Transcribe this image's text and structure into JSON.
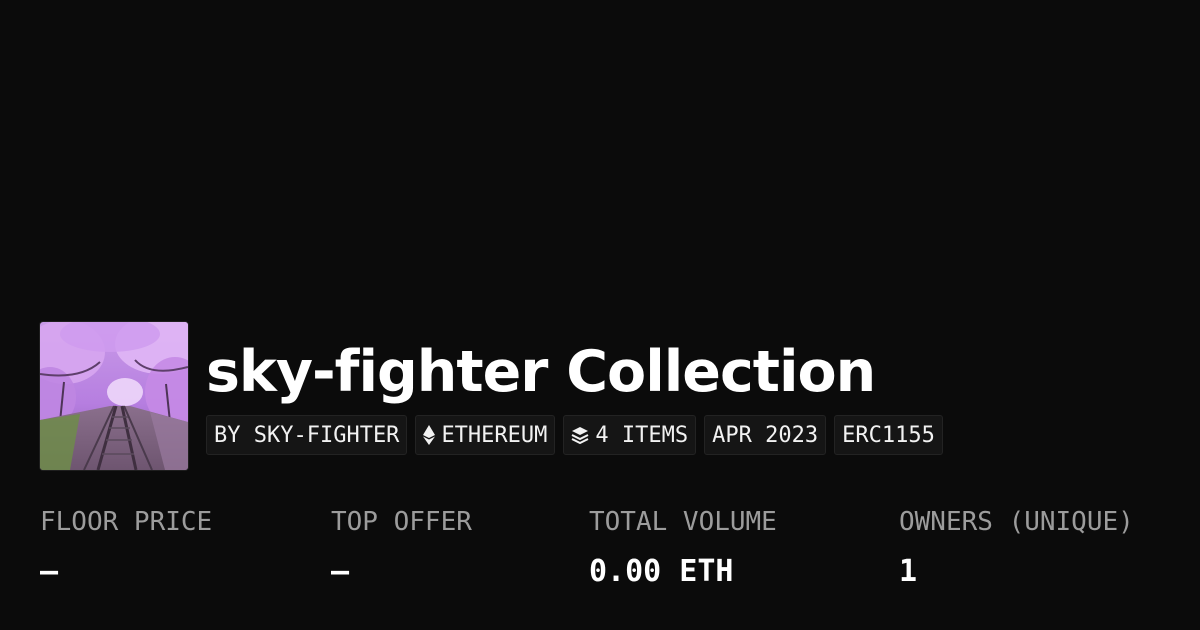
{
  "collection": {
    "title": "sky-fighter Collection",
    "thumbnail_icon": "cherry-blossom-railway-image"
  },
  "tags": {
    "creator": "BY SKY-FIGHTER",
    "chain": "ETHEREUM",
    "chain_icon": "ethereum-icon",
    "items": "4 ITEMS",
    "items_icon": "layers-icon",
    "date": "APR 2023",
    "standard": "ERC1155"
  },
  "stats": {
    "floor_price": {
      "label": "FLOOR PRICE",
      "value": "–"
    },
    "top_offer": {
      "label": "TOP OFFER",
      "value": "–"
    },
    "total_volume": {
      "label": "TOTAL VOLUME",
      "value": "0.00 ETH"
    },
    "owners": {
      "label": "OWNERS (UNIQUE)",
      "value": "1"
    }
  },
  "colors": {
    "background": "#0b0b0b",
    "text": "#ffffff",
    "muted": "#9c9c9c",
    "tag_background": "#151515"
  }
}
